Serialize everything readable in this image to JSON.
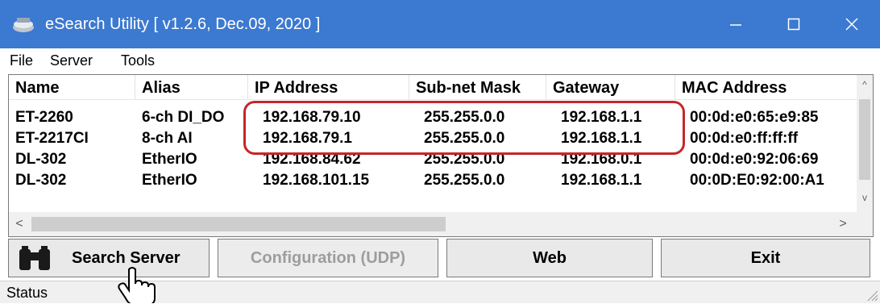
{
  "window": {
    "title": "eSearch Utility [ v1.2.6, Dec.09, 2020 ]"
  },
  "menu": [
    "File",
    "Server",
    "Tools"
  ],
  "table": {
    "columns": [
      "Name",
      "Alias",
      "IP Address",
      "Sub-net Mask",
      "Gateway",
      "MAC Address"
    ],
    "rows": [
      [
        "ET-2260",
        "6-ch DI_DO",
        "192.168.79.10",
        "255.255.0.0",
        "192.168.1.1",
        "00:0d:e0:65:e9:85"
      ],
      [
        "ET-2217CI",
        "8-ch AI",
        "192.168.79.1",
        "255.255.0.0",
        "192.168.1.1",
        "00:0d:e0:ff:ff:ff"
      ],
      [
        "DL-302",
        "EtherIO",
        "192.168.84.62",
        "255.255.0.0",
        "192.168.0.1",
        "00:0d:e0:92:06:69"
      ],
      [
        "DL-302",
        "EtherIO",
        "192.168.101.15",
        "255.255.0.0",
        "192.168.1.1",
        "00:0D:E0:92:00:A1"
      ]
    ]
  },
  "buttons": {
    "search": "Search Server",
    "config": "Configuration (UDP)",
    "web": "Web",
    "exit": "Exit"
  },
  "status": "Status",
  "colors": {
    "titlebar": "#3c79d0",
    "highlight": "#c5262a"
  }
}
